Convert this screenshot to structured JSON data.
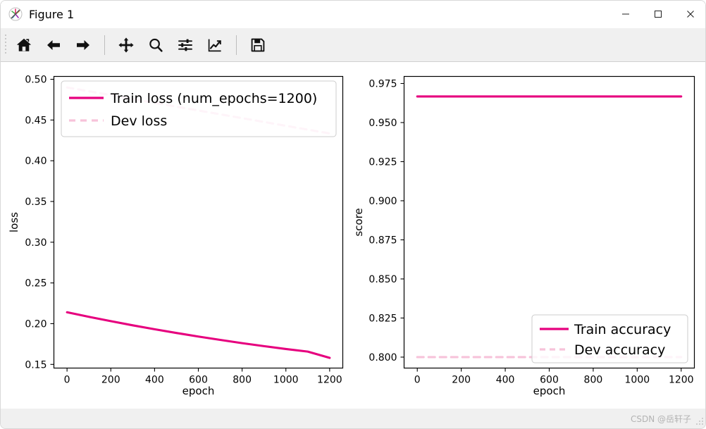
{
  "window": {
    "title": "Figure 1",
    "icon": "matplotlib-logo-icon",
    "minimize_label": "–",
    "maximize_label": "☐",
    "close_label": "✕"
  },
  "toolbar": {
    "buttons": [
      {
        "name": "home-icon",
        "tooltip": "Reset original view"
      },
      {
        "name": "back-arrow-icon",
        "tooltip": "Back to previous view"
      },
      {
        "name": "forward-arrow-icon",
        "tooltip": "Forward to next view"
      },
      {
        "name": "pan-move-icon",
        "tooltip": "Pan axes with left mouse, zoom with right"
      },
      {
        "name": "zoom-magnifier-icon",
        "tooltip": "Zoom to rectangle"
      },
      {
        "name": "configure-subplots-sliders-icon",
        "tooltip": "Configure subplots"
      },
      {
        "name": "edit-axis-curve-icon",
        "tooltip": "Edit axis, curve and image parameters"
      },
      {
        "name": "save-floppy-icon",
        "tooltip": "Save the figure"
      }
    ]
  },
  "statusbar": {
    "watermark": "CSDN @岳轩子"
  },
  "colors": {
    "train": "#e6007e",
    "dev": "#f7c3da",
    "axis": "#000000",
    "figure_bg": "#ffffff",
    "toolbar_bg": "#f0f0f0"
  },
  "chart_data": [
    {
      "type": "line",
      "id": "loss-plot",
      "title": "",
      "xlabel": "epoch",
      "ylabel": "loss",
      "xlim": [
        -60,
        1260
      ],
      "ylim": [
        0.1455,
        0.5035
      ],
      "xticks": [
        0,
        200,
        400,
        600,
        800,
        1000,
        1200
      ],
      "xticklabels": [
        "0",
        "200",
        "400",
        "600",
        "800",
        "1000",
        "1200"
      ],
      "yticks": [
        0.15,
        0.2,
        0.25,
        0.3,
        0.35,
        0.4,
        0.45,
        0.5
      ],
      "yticklabels": [
        "0.15",
        "0.20",
        "0.25",
        "0.30",
        "0.35",
        "0.40",
        "0.45",
        "0.50"
      ],
      "grid": false,
      "legend_position": "upper left",
      "x": [
        0,
        100,
        200,
        300,
        400,
        500,
        600,
        700,
        800,
        900,
        1000,
        1100,
        1200
      ],
      "series": [
        {
          "name": "Train loss (num_epochs=1200)",
          "style": "solid",
          "color": "#e6007e",
          "values": [
            0.214,
            0.2084,
            0.2031,
            0.198,
            0.1932,
            0.1886,
            0.1842,
            0.1801,
            0.1761,
            0.1724,
            0.1689,
            0.1657,
            0.158
          ]
        },
        {
          "name": "Dev loss",
          "style": "dashed",
          "color": "#f7c3da",
          "values": [
            0.49,
            0.4853,
            0.4806,
            0.4758,
            0.4711,
            0.4664,
            0.4617,
            0.457,
            0.4523,
            0.4476,
            0.4429,
            0.4382,
            0.4335
          ]
        }
      ]
    },
    {
      "type": "line",
      "id": "score-plot",
      "title": "",
      "xlabel": "epoch",
      "ylabel": "score",
      "xlim": [
        -60,
        1260
      ],
      "ylim": [
        0.793,
        0.9795
      ],
      "xticks": [
        0,
        200,
        400,
        600,
        800,
        1000,
        1200
      ],
      "xticklabels": [
        "0",
        "200",
        "400",
        "600",
        "800",
        "1000",
        "1200"
      ],
      "yticks": [
        0.8,
        0.825,
        0.85,
        0.875,
        0.9,
        0.925,
        0.95,
        0.975
      ],
      "yticklabels": [
        "0.800",
        "0.825",
        "0.850",
        "0.875",
        "0.900",
        "0.925",
        "0.950",
        "0.975"
      ],
      "grid": false,
      "legend_position": "lower right",
      "x": [
        0,
        200,
        400,
        600,
        800,
        1000,
        1200
      ],
      "series": [
        {
          "name": "Train accuracy",
          "style": "solid",
          "color": "#e6007e",
          "values": [
            0.9667,
            0.9667,
            0.9667,
            0.9667,
            0.9667,
            0.9667,
            0.9667
          ]
        },
        {
          "name": "Dev accuracy",
          "style": "dashed",
          "color": "#f7c3da",
          "values": [
            0.8,
            0.8,
            0.8,
            0.8,
            0.8,
            0.8,
            0.8
          ]
        }
      ]
    }
  ]
}
